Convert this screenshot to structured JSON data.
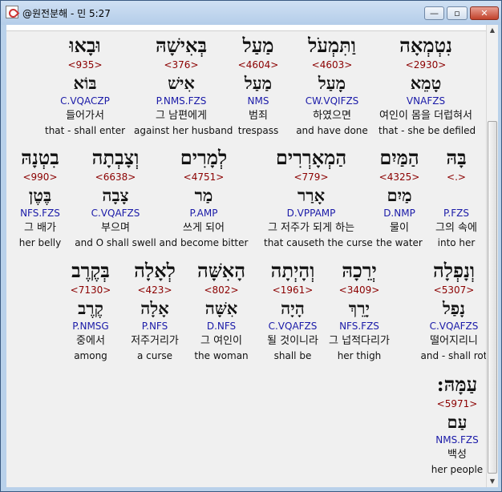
{
  "window": {
    "title": "@원전분해 - 민 5:27",
    "buttons": {
      "minimize": "—",
      "maximize": "▫",
      "close": "✕"
    }
  },
  "rows": [
    [
      {
        "heb": "נִטְמְאָה",
        "num": "<2930>",
        "root": "טָמֵא",
        "code": "VNAFZS",
        "kor": "여인이 몸을 더럽혀서",
        "eng": "that - she be defiled"
      },
      {
        "heb": "וַתִּמְעֹל",
        "num": "<4603>",
        "root": "מָעַל",
        "code": "CW.VQIFZS",
        "kor": "하였으면",
        "eng": "and have done"
      },
      {
        "heb": "מַעַל",
        "num": "<4604>",
        "root": "מַעַל",
        "code": "NMS",
        "kor": "범죄",
        "eng": "trespass"
      },
      {
        "heb": "בְּאִישָׁהּ",
        "num": "<376>",
        "root": "אִישׁ",
        "code": "P.NMS.FZS",
        "kor": "그 남편에게",
        "eng": "against her husband"
      },
      {
        "heb": "וּבָאוּ",
        "num": "<935>",
        "root": "בּוֹא",
        "code": "C.VQACZP",
        "kor": "들어가서",
        "eng": "that - shall enter"
      }
    ],
    [
      {
        "heb": "בָּהּ",
        "num": "<.>",
        "root": "",
        "code": "P.FZS",
        "kor": "그의 속에",
        "eng": "into her"
      },
      {
        "heb": "הַמַּיִם",
        "num": "<4325>",
        "root": "מַיִם",
        "code": "D.NMP",
        "kor": "물이",
        "eng": "the water"
      },
      {
        "heb": "הַמְאָרְרִים",
        "num": "<779>",
        "root": "אָרַר",
        "code": "D.VPPAMP",
        "kor": "그 저주가 되게 하는",
        "eng": "that causeth the curse"
      },
      {
        "heb": "לְמָרִים",
        "num": "<4751>",
        "root": "מַר",
        "code": "P.AMP",
        "kor": "쓰게 되어",
        "eng": "and become bitter"
      },
      {
        "heb": "וְצָבְתָה",
        "num": "<6638>",
        "root": "צָבָה",
        "code": "C.VQAFZS",
        "kor": "부으며",
        "eng": "and O shall swell"
      },
      {
        "heb": "בִטְנָהּ",
        "num": "<990>",
        "root": "בֶּטֶן",
        "code": "NFS.FZS",
        "kor": "그 배가",
        "eng": "her belly"
      }
    ],
    [
      {
        "heb": "וְנָפְלָה",
        "num": "<5307>",
        "root": "נָפַל",
        "code": "C.VQAFZS",
        "kor": "떨어지리니",
        "eng": "and - shall rot"
      },
      {
        "heb": "יְרֵכָהּ",
        "num": "<3409>",
        "root": "יָרֵךְ",
        "code": "NFS.FZS",
        "kor": "그 넙적다리가",
        "eng": "her thigh"
      },
      {
        "heb": "וְהָיְתָה",
        "num": "<1961>",
        "root": "הָיָה",
        "code": "C.VQAFZS",
        "kor": "될 것이니라",
        "eng": "shall be"
      },
      {
        "heb": "הָאִשָּׁה",
        "num": "<802>",
        "root": "אִשָּׁה",
        "code": "D.NFS",
        "kor": "그 여인이",
        "eng": "the woman"
      },
      {
        "heb": "לְאָלָה",
        "num": "<423>",
        "root": "אָלָה",
        "code": "P.NFS",
        "kor": "저주거리가",
        "eng": "a curse"
      },
      {
        "heb": "בְּקֶרֶב",
        "num": "<7130>",
        "root": "קֶרֶב",
        "code": "P.NMSG",
        "kor": "중에서",
        "eng": "among"
      }
    ],
    [
      {
        "heb": "עַמָּהּ:",
        "num": "<5971>",
        "root": "עַם",
        "code": "NMS.FZS",
        "kor": "백성",
        "eng": "her people"
      }
    ]
  ]
}
